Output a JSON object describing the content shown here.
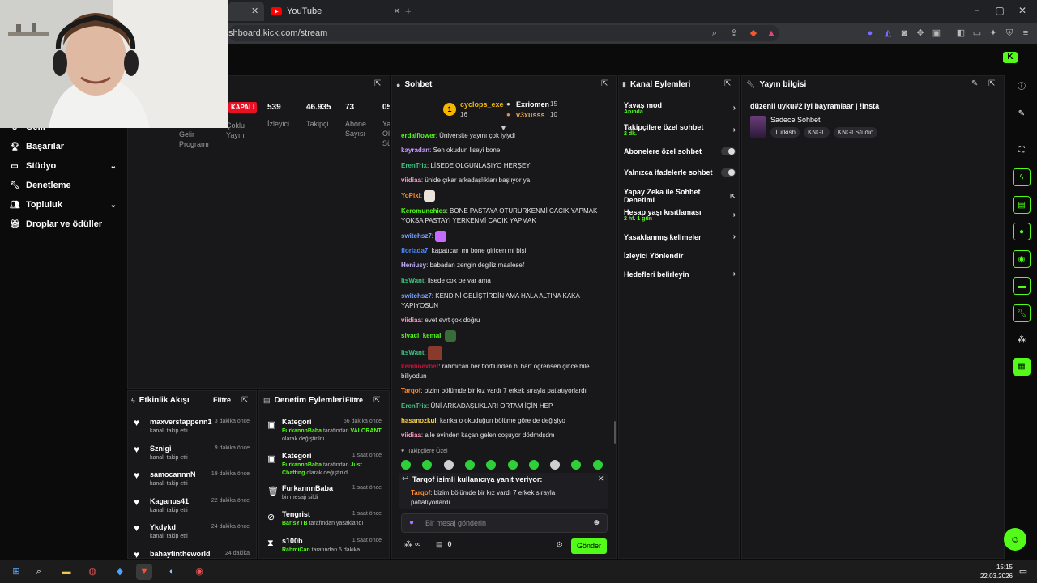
{
  "browser": {
    "tab_active_close": "✕",
    "tab_youtube": "YouTube",
    "new_tab": "+",
    "url": "shboard.kick.com/stream",
    "win_min": "−",
    "win_max": "▢",
    "win_close": "✕"
  },
  "sidebar": {
    "items": [
      {
        "label": "Gelir",
        "icon": "revenue-icon"
      },
      {
        "label": "Başarılar",
        "icon": "trophy-icon"
      },
      {
        "label": "Stüdyo",
        "icon": "studio-icon",
        "expandable": true
      },
      {
        "label": "Denetleme",
        "icon": "wrench-icon"
      },
      {
        "label": "Topluluk",
        "icon": "people-icon",
        "expandable": true
      },
      {
        "label": "Droplar ve ödüller",
        "icon": "gift-icon"
      }
    ]
  },
  "stats": {
    "status_badge": "KAPALI",
    "items": [
      {
        "value": "539",
        "label": "İzleyici"
      },
      {
        "value": "46.935",
        "label": "Takipçi"
      },
      {
        "value": "73",
        "label": "Abone Sayısı"
      },
      {
        "value": "05",
        "label": "Ya Ol Sü"
      }
    ],
    "partial_left_1": "Gelir Programı",
    "partial_left_2": "Çoklu Yayın"
  },
  "chat": {
    "title": "Sohbet",
    "top_gifters": [
      {
        "rank": "1",
        "name": "cyclops_exe",
        "count": "16"
      },
      {
        "name": "Exriomen",
        "count": "15"
      },
      {
        "name": "v3xusss",
        "count": "10"
      }
    ],
    "messages": [
      {
        "user": "erdalflower",
        "color": "#53fc18",
        "text": "Üniversite yayını çok iyiydi"
      },
      {
        "user": "kayradan",
        "color": "#c99cff",
        "text": "Sen okudun liseyi bone"
      },
      {
        "user": "ErenTrix",
        "color": "#3fbf7f",
        "text": "LİSEDE OLGUNLAŞIYO HERŞEY"
      },
      {
        "user": "viidiaa",
        "color": "#ff9dc4",
        "text": "ünide çıkar arkadaşlıkları başlıyor ya"
      },
      {
        "user": "YoPixi",
        "color": "#ff8c2a",
        "text": ""
      },
      {
        "user": "Keromunchies",
        "color": "#53fc18",
        "text": "BONE PASTAYA OTURURKENMİ CACIK YAPMAK YOKSA PASTAYI YERKENMİ CACIK YAPMAK"
      },
      {
        "user": "switchsz7",
        "color": "#7aa7ff",
        "text": ""
      },
      {
        "user": "floriada7",
        "color": "#4b8dff",
        "text": "kapatıcan mı bone giricen mi bişi"
      },
      {
        "user": "Heniusy",
        "color": "#c9b6ff",
        "text": "babadan zengin degiliz maalesef"
      },
      {
        "user": "ItsWant",
        "color": "#3fbf7f",
        "text": "lisede cok oe var ama"
      },
      {
        "user": "switchsz7",
        "color": "#7aa7ff",
        "text": "KENDİNİ GELİŞTİRDİN AMA HALA ALTINA KAKA YAPIYOSUN"
      },
      {
        "user": "viidiaa",
        "color": "#ff9dc4",
        "text": "evet evrt çok doğru"
      },
      {
        "user": "sivaci_kemal",
        "color": "#53fc18",
        "text": ""
      },
      {
        "user": "ItsWant",
        "color": "#3fbf7f",
        "text": ""
      },
      {
        "user": "kemlinexbet",
        "color": "#c0143c",
        "text": "rahmican her flörtlünden bi harf öğrensen çince bile biliyodun"
      },
      {
        "user": "Tarqof",
        "color": "#ff8c2a",
        "text": "bizim bölümde bir kız vardı 7 erkek sırayla patlatıyorlardı"
      },
      {
        "user": "ErenTrix",
        "color": "#3fbf7f",
        "text": "ÜNİ ARKADAŞLIKLARI ORTAM İÇİN HEP"
      },
      {
        "user": "hasanozkul",
        "color": "#ffd54a",
        "text": "kanka o okuduğun bölüme göre de değişiyo"
      },
      {
        "user": "viidiaa",
        "color": "#ff9dc4",
        "text": "aile evinden kaçan gelen coşuyor dödmdşdm"
      }
    ],
    "emote_label": "Takipçilere Özel",
    "reply_title": "Tarqof isimli kullanıcıya yanıt veriyor:",
    "reply_user": "Tarqof",
    "reply_text": "bizim bölümde bir kız vardı 7 erkek sırayla patlatıyorlardı",
    "input_placeholder": "Bir mesaj gönderin",
    "points": "∞",
    "gift_count": "0",
    "send_label": "Gönder"
  },
  "channel_actions": {
    "title": "Kanal Eylemleri",
    "items": [
      {
        "label": "Yavaş mod",
        "sub": "Anında",
        "control": "chevron"
      },
      {
        "label": "Takipçilere özel sohbet",
        "sub": "2 dk.",
        "control": "chevron"
      },
      {
        "label": "Abonelere özel sohbet",
        "sub": "",
        "control": "toggle"
      },
      {
        "label": "Yalnızca ifadelerle sohbet",
        "sub": "",
        "control": "toggle"
      },
      {
        "label": "Yapay Zeka ile Sohbet Denetimi",
        "sub": "",
        "control": "external"
      },
      {
        "label": "Hesap yaşı kısıtlaması",
        "sub": "2 hf. 1 gün",
        "control": "chevron"
      },
      {
        "label": "Yasaklanmış kelimeler",
        "sub": "",
        "control": "chevron"
      },
      {
        "label": "İzleyici Yönlendir",
        "sub": "",
        "control": "none"
      },
      {
        "label": "Hedefleri belirleyin",
        "sub": "",
        "control": "chevron"
      }
    ]
  },
  "stream_info": {
    "title": "Yayın bilgisi",
    "stream_title": "düzenli uyku#2 iyi bayramlaar | !insta",
    "category": "Sadece Sohbet",
    "tags": [
      "Turkish",
      "KNGL",
      "KNGLStudio"
    ]
  },
  "activity": {
    "title": "Etkinlik Akışı",
    "filter": "Filtre",
    "items": [
      {
        "name": "maxverstappenn1",
        "sub": "kanalı takip etti",
        "time": "3 dakika önce"
      },
      {
        "name": "Sznigi",
        "sub": "kanalı takip etti",
        "time": "9 dakika önce"
      },
      {
        "name": "samocannnN",
        "sub": "kanalı takip etti",
        "time": "19 dakika önce"
      },
      {
        "name": "Kaganus41",
        "sub": "kanalı takip etti",
        "time": "22 dakika önce"
      },
      {
        "name": "Ykdykd",
        "sub": "kanalı takip etti",
        "time": "24 dakika önce"
      },
      {
        "name": "bahaytintheworld",
        "sub": "",
        "time": "24 dakika"
      }
    ]
  },
  "moderation": {
    "title": "Denetim Eylemleri",
    "filter": "Filtre",
    "items": [
      {
        "title": "Kategori",
        "time": "56 dakika önce",
        "actor": "FurkannnBaba",
        "mid": " tarafından ",
        "target": "VALORANT",
        "tail": " olarak değiştirildi",
        "icon": "category-icon"
      },
      {
        "title": "Kategori",
        "time": "1 saat önce",
        "actor": "FurkannnBaba",
        "mid": " tarafından ",
        "target": "Just Chatting",
        "tail": " olarak değiştirildi",
        "icon": "category-icon"
      },
      {
        "title": "FurkannnBaba",
        "time": "1 saat önce",
        "actor": "",
        "mid": "",
        "target": "",
        "tail": "bir mesajı sildi",
        "icon": "trash-icon"
      },
      {
        "title": "Tengrist",
        "time": "1 saat önce",
        "actor": "BarisYTB",
        "mid": "",
        "target": "",
        "tail": " tarafından yasaklandı",
        "icon": "ban-icon"
      },
      {
        "title": "s100b",
        "time": "1 saat önce",
        "actor": "RahmiCan",
        "mid": "",
        "target": "",
        "tail": " tarafından 5 dakika",
        "icon": "timer-icon"
      }
    ]
  },
  "taskbar": {
    "time": "15:15",
    "date": "22.03.2026"
  },
  "colors": {
    "accent": "#53fc18",
    "panel": "#18181b",
    "live_badge": "#e81123"
  }
}
